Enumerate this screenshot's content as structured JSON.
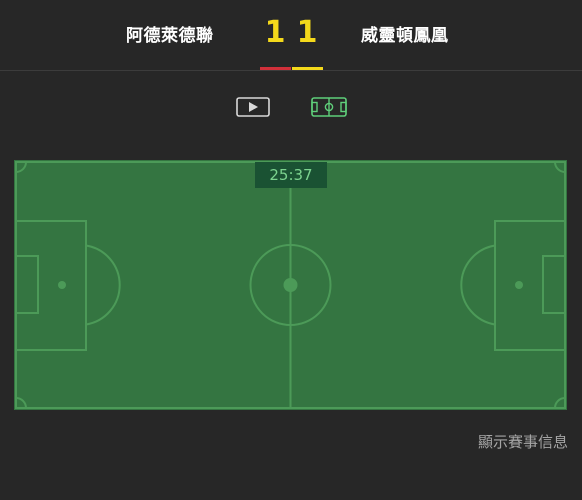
{
  "match": {
    "home_team": "阿德萊德聯",
    "away_team": "威靈頓鳳凰",
    "home_score": "1",
    "away_score": "1",
    "home_color": "#d1303a",
    "away_color": "#f4d91b"
  },
  "view_toggle": {
    "video_icon": "play-video-icon",
    "field_icon": "pitch-view-icon",
    "active": "field"
  },
  "pitch": {
    "clock": "25:37",
    "grass_color": "#347541",
    "line_color": "#4c9a58"
  },
  "footer": {
    "info_link": "顯示賽事信息"
  }
}
